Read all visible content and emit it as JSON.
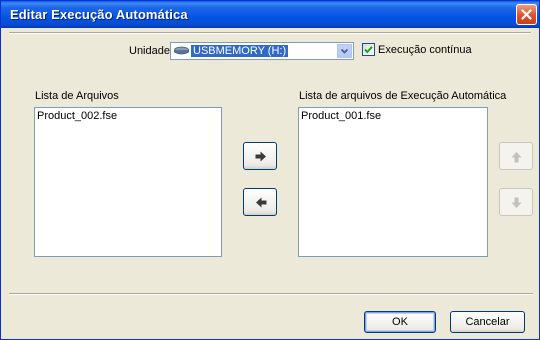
{
  "window": {
    "title": "Editar Execução Automática"
  },
  "drive": {
    "label": "Unidade",
    "value": "USBMEMORY (H:)"
  },
  "continuous": {
    "label": "Execução contínua",
    "checked": true
  },
  "file_list": {
    "label": "Lista de Arquivos",
    "items": [
      "Product_002.fse"
    ]
  },
  "autorun_list": {
    "label": "Lista de arquivos de Execução Automática",
    "items": [
      "Product_001.fse"
    ]
  },
  "buttons": {
    "ok": "OK",
    "cancel": "Cancelar"
  },
  "icons": {
    "close": "close-icon",
    "drive": "drive-icon",
    "dropdown": "chevron-down-icon",
    "checkmark": "checkmark-icon",
    "add": "arrow-right-icon",
    "remove": "arrow-left-icon",
    "move_up": "arrow-up-icon",
    "move_down": "arrow-down-icon"
  }
}
